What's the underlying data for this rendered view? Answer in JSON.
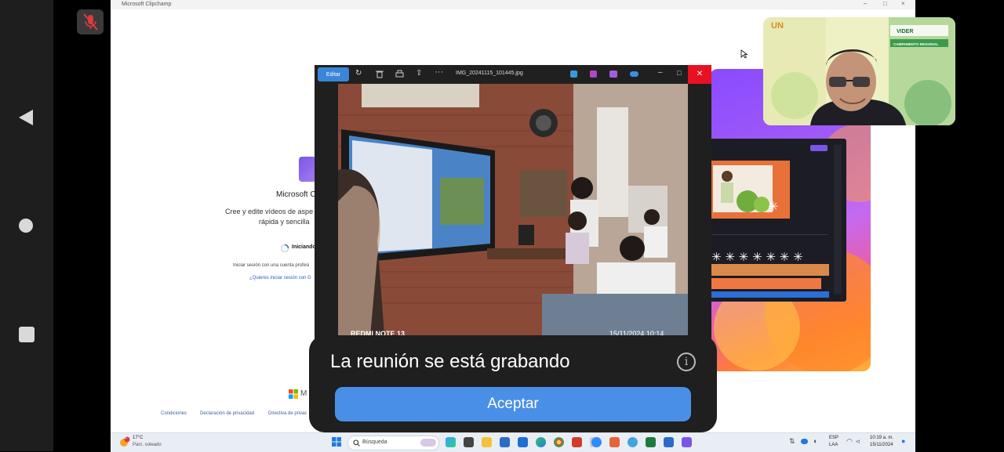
{
  "app_window": {
    "title": "Microsoft Clipchamp"
  },
  "clipchamp": {
    "brand": "Microsoft C",
    "tagline_line1": "Cree y edite vídeos de aspe",
    "tagline_line2": "rápida y sencilla",
    "loading": "Iniciando",
    "signin_hint": "Iniciar sesión con una cuenta profesi",
    "alt_signin": "¿Quieres iniciar sesión con G",
    "footer_logo": "M",
    "footer_links": [
      "Condiciones",
      "Declaración de privacidad",
      "Directiva de privac"
    ]
  },
  "photos_viewer": {
    "edit_label": "Editar",
    "filename": "IMG_20241115_101445.jpg",
    "watermark_device": "REDMI NOTE 13",
    "watermark_datetime": "15/11/2024  10:14"
  },
  "webcam": {
    "logo_text": "UN",
    "org": "VIDER",
    "banner_title": "CAMPAMENTO REGIONAL"
  },
  "recording_dialog": {
    "message": "La reunión se está grabando",
    "accept_label": "Aceptar",
    "info_icon": "i"
  },
  "taskbar": {
    "weather_temp": "17°C",
    "weather_desc": "Parc. soleado",
    "weather_badge": "1",
    "search_label": "Búsqueda",
    "lang_line1": "ESP",
    "lang_line2": "LAA",
    "time": "10:19 a. m.",
    "date": "15/11/2024"
  },
  "colors": {
    "accent": "#4a8fe7",
    "dialog_bg": "#1f1f1f",
    "close_red": "#e81123"
  }
}
